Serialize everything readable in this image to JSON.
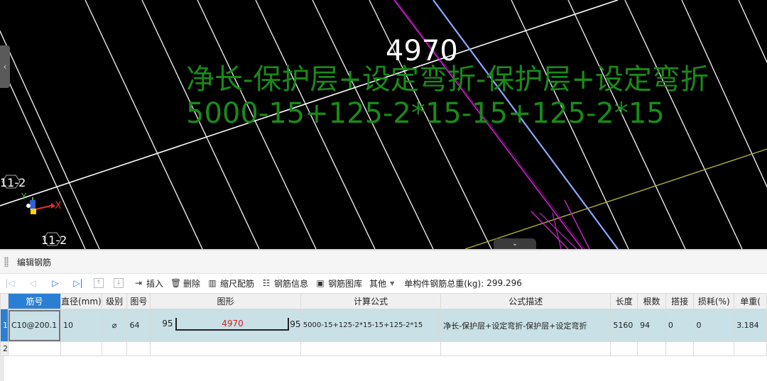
{
  "cad": {
    "dimension_value": "4970",
    "formula_description": "净长-保护层+设定弯折-保护层+设定弯折",
    "formula_calc": "5000-15+125-2*15-15+125-2*15",
    "axis_label_top": "11-2",
    "axis_label_bottom": "11-2",
    "axis_x": "X",
    "axis_y": "Y",
    "side_handle_icon": "chevron-left-icon",
    "collapse_icon": "chevron-down-icon",
    "colors": {
      "background": "#000000",
      "formula": "#1a8a1a",
      "rebar_line": "#ffffff",
      "magenta": "#cc22cc",
      "blue": "#8fa8ff",
      "yellow": "#b0b030"
    }
  },
  "panel": {
    "title": "编辑钢筋",
    "toolbar": {
      "insert": "插入",
      "delete": "删除",
      "scale_rebar": "缩尺配筋",
      "rebar_info": "钢筋信息",
      "rebar_library": "钢筋图库",
      "other": "其他",
      "total_weight_label": "单构件钢筋总重(kg):",
      "total_weight_value": "299.296"
    },
    "columns": [
      "筋号",
      "直径(mm)",
      "级别",
      "图号",
      "图形",
      "计算公式",
      "公式描述",
      "长度",
      "根数",
      "搭接",
      "损耗(%)",
      "单重("
    ],
    "rows": [
      {
        "num": "1",
        "code": "C10@200.1",
        "diameter": "10",
        "grade": "⌀",
        "figure_no": "64",
        "shape_left": "95",
        "shape_mid": "4970",
        "shape_right": "95",
        "formula": "5000-15+125-2*15-15+125-2*15",
        "description": "净长-保护层+设定弯折-保护层+设定弯折",
        "length": "5160",
        "count": "94",
        "lap": "0",
        "loss": "0",
        "unit_weight": "3.184"
      }
    ],
    "empty_row_num": "2"
  }
}
